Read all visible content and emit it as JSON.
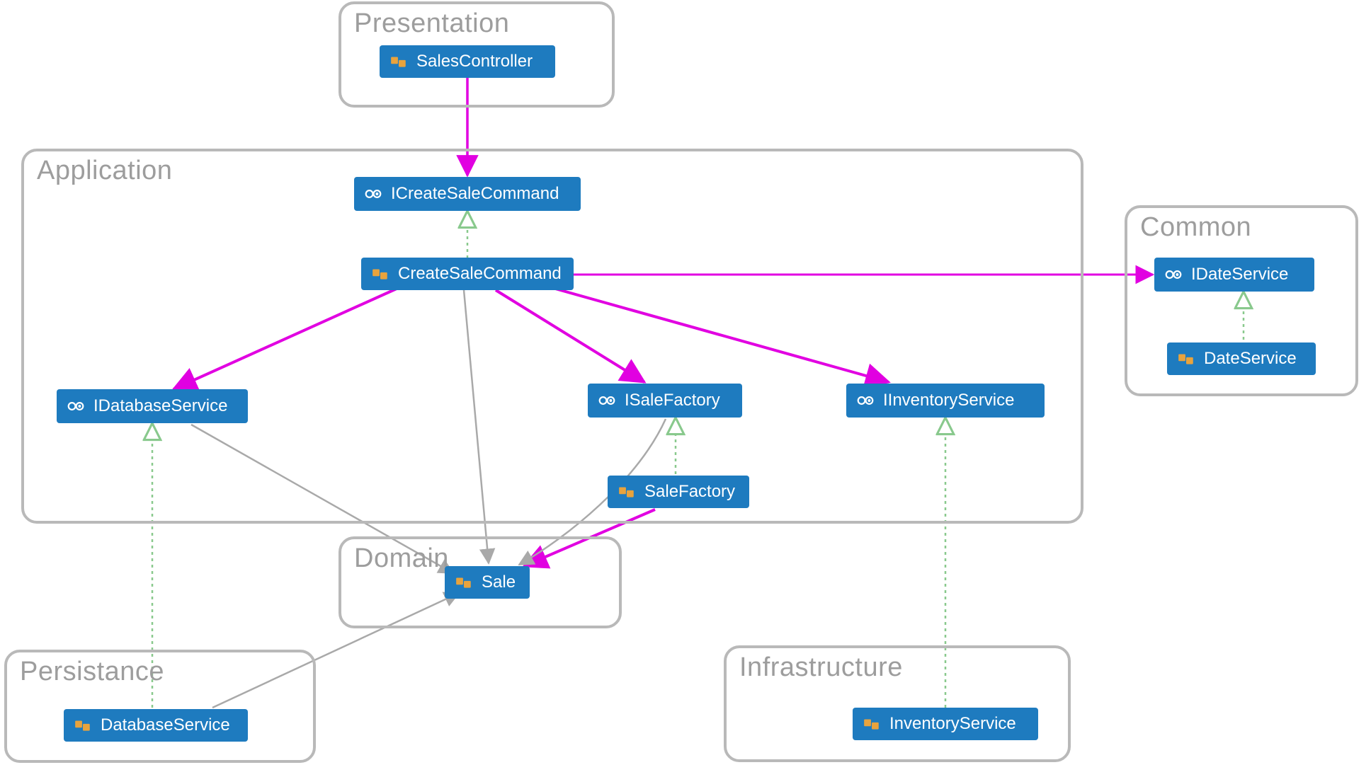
{
  "colors": {
    "node_fill": "#1e7bbf",
    "node_text": "#ffffff",
    "group_border": "#b9b9b9",
    "group_label": "#9d9d9d",
    "arrow_depends": "#e100e1",
    "arrow_realize": "#89c98d",
    "arrow_assoc": "#a9a9a9",
    "icon_accent": "#e8a33d"
  },
  "groups": {
    "presentation": {
      "label": "Presentation"
    },
    "application": {
      "label": "Application"
    },
    "common": {
      "label": "Common"
    },
    "domain": {
      "label": "Domain"
    },
    "persistance": {
      "label": "Persistance"
    },
    "infrastructure": {
      "label": "Infrastructure"
    }
  },
  "nodes": {
    "salesController": {
      "label": "SalesController",
      "kind": "class",
      "group": "presentation"
    },
    "iCreateSaleCommand": {
      "label": "ICreateSaleCommand",
      "kind": "interface",
      "group": "application"
    },
    "createSaleCommand": {
      "label": "CreateSaleCommand",
      "kind": "class",
      "group": "application"
    },
    "iDatabaseService": {
      "label": "IDatabaseService",
      "kind": "interface",
      "group": "application"
    },
    "iSaleFactory": {
      "label": "ISaleFactory",
      "kind": "interface",
      "group": "application"
    },
    "iInventoryService": {
      "label": "IInventoryService",
      "kind": "interface",
      "group": "application"
    },
    "saleFactory": {
      "label": "SaleFactory",
      "kind": "class",
      "group": "application"
    },
    "iDateService": {
      "label": "IDateService",
      "kind": "interface",
      "group": "common"
    },
    "dateService": {
      "label": "DateService",
      "kind": "class",
      "group": "common"
    },
    "sale": {
      "label": "Sale",
      "kind": "class",
      "group": "domain"
    },
    "databaseService": {
      "label": "DatabaseService",
      "kind": "class",
      "group": "persistance"
    },
    "inventoryService": {
      "label": "InventoryService",
      "kind": "class",
      "group": "infrastructure"
    }
  },
  "edges": [
    {
      "from": "salesController",
      "to": "iCreateSaleCommand",
      "type": "depends"
    },
    {
      "from": "createSaleCommand",
      "to": "iCreateSaleCommand",
      "type": "realize"
    },
    {
      "from": "createSaleCommand",
      "to": "iDatabaseService",
      "type": "depends"
    },
    {
      "from": "createSaleCommand",
      "to": "iSaleFactory",
      "type": "depends"
    },
    {
      "from": "createSaleCommand",
      "to": "iInventoryService",
      "type": "depends"
    },
    {
      "from": "createSaleCommand",
      "to": "iDateService",
      "type": "depends"
    },
    {
      "from": "createSaleCommand",
      "to": "sale",
      "type": "assoc"
    },
    {
      "from": "iDatabaseService",
      "to": "sale",
      "type": "assoc"
    },
    {
      "from": "iSaleFactory",
      "to": "sale",
      "type": "assoc"
    },
    {
      "from": "saleFactory",
      "to": "iSaleFactory",
      "type": "realize"
    },
    {
      "from": "saleFactory",
      "to": "sale",
      "type": "depends"
    },
    {
      "from": "databaseService",
      "to": "iDatabaseService",
      "type": "realize"
    },
    {
      "from": "databaseService",
      "to": "sale",
      "type": "assoc"
    },
    {
      "from": "inventoryService",
      "to": "iInventoryService",
      "type": "realize"
    },
    {
      "from": "dateService",
      "to": "iDateService",
      "type": "realize"
    }
  ]
}
